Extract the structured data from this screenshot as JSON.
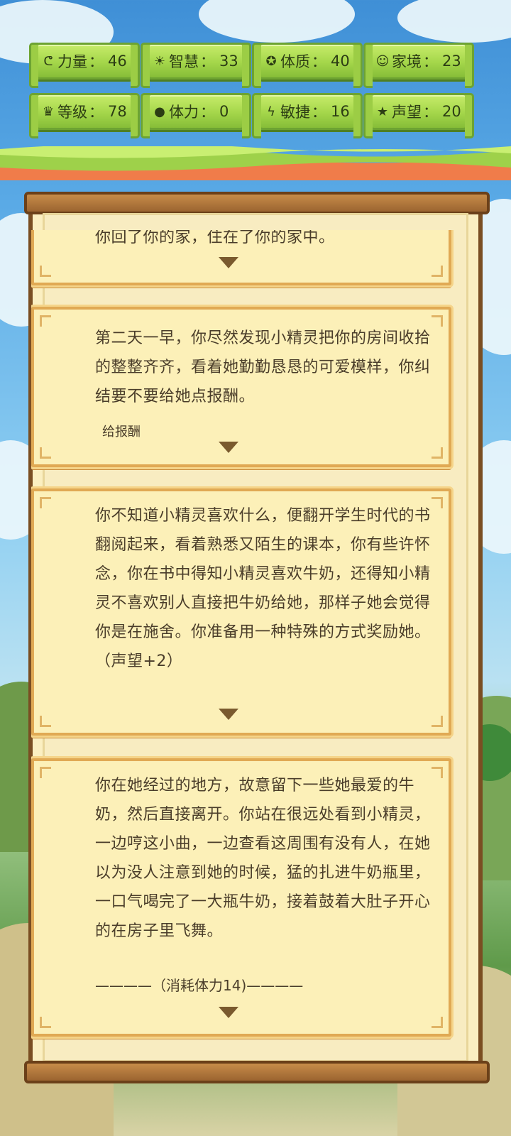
{
  "stats": [
    {
      "icon": "muscle-icon",
      "glyph": "💪",
      "label": "力量",
      "value": "46"
    },
    {
      "icon": "bulb-icon",
      "glyph": "☀",
      "label": "智慧",
      "value": "33"
    },
    {
      "icon": "body-icon",
      "glyph": "✪",
      "label": "体质",
      "value": "40"
    },
    {
      "icon": "family-icon",
      "glyph": "☺",
      "label": "家境",
      "value": "23"
    },
    {
      "icon": "crown-icon",
      "glyph": "♛",
      "label": "等级",
      "value": "78"
    },
    {
      "icon": "heart-icon",
      "glyph": "●",
      "label": "体力",
      "value": "0"
    },
    {
      "icon": "lightning-icon",
      "glyph": "⚡",
      "label": "敏捷",
      "value": "16"
    },
    {
      "icon": "star-icon",
      "glyph": "★",
      "label": "声望",
      "value": "20"
    }
  ],
  "story": {
    "cards": [
      {
        "text": "你回了你的家，住在了你的家中。"
      },
      {
        "text": "第二天一早，你尽然发现小精灵把你的房间收拾的整整齐齐，看着她勤勤恳恳的可爱模样，你纠结要不要给她点报酬。",
        "choice": "给报酬"
      },
      {
        "text": "你不知道小精灵喜欢什么，便翻开学生时代的书翻阅起来，看着熟悉又陌生的课本，你有些许怀念，你在书中得知小精灵喜欢牛奶，还得知小精灵不喜欢别人直接把牛奶给她，那样子她会觉得你是在施舍。你准备用一种特殊的方式奖励她。（声望+2）"
      },
      {
        "text": "你在她经过的地方，故意留下一些她最爱的牛奶，然后直接离开。你站在很远处看到小精灵，一边哼这小曲，一边查看这周围有没有人，在她以为没人注意到她的时候，猛的扎进牛奶瓶里，一口气喝完了一大瓶牛奶，接着鼓着大肚子开心的在房子里飞舞。",
        "footer": "————（消耗体力14)————"
      }
    ]
  },
  "colors": {
    "stat_green": "#a4d64a",
    "card_bg": "#fcf0b8",
    "card_border": "#e0a954",
    "text": "#4a3d2a",
    "frame_wood": "#7a4e22"
  }
}
